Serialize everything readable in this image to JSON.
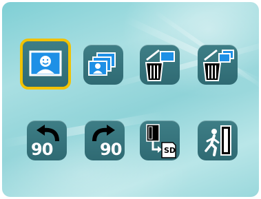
{
  "menu": {
    "items": [
      {
        "name": "view-photo",
        "icon": "single-photo-icon",
        "selected": true
      },
      {
        "name": "view-all-photos",
        "icon": "multiple-photos-icon",
        "selected": false
      },
      {
        "name": "delete-photo",
        "icon": "delete-single-icon",
        "selected": false
      },
      {
        "name": "delete-all",
        "icon": "delete-multiple-icon",
        "selected": false
      },
      {
        "name": "rotate-left",
        "icon": "rotate-left-icon",
        "label": "90",
        "selected": false
      },
      {
        "name": "rotate-right",
        "icon": "rotate-right-icon",
        "label": "90",
        "selected": false
      },
      {
        "name": "copy-to-sd",
        "icon": "copy-to-sd-icon",
        "label": "SD",
        "selected": false
      },
      {
        "name": "exit",
        "icon": "exit-icon",
        "selected": false
      }
    ]
  },
  "colors": {
    "background": "#8fd3d8",
    "tile": "#2f6a73",
    "selection": "#f2c200",
    "accent_blue": "#1e90e6"
  }
}
